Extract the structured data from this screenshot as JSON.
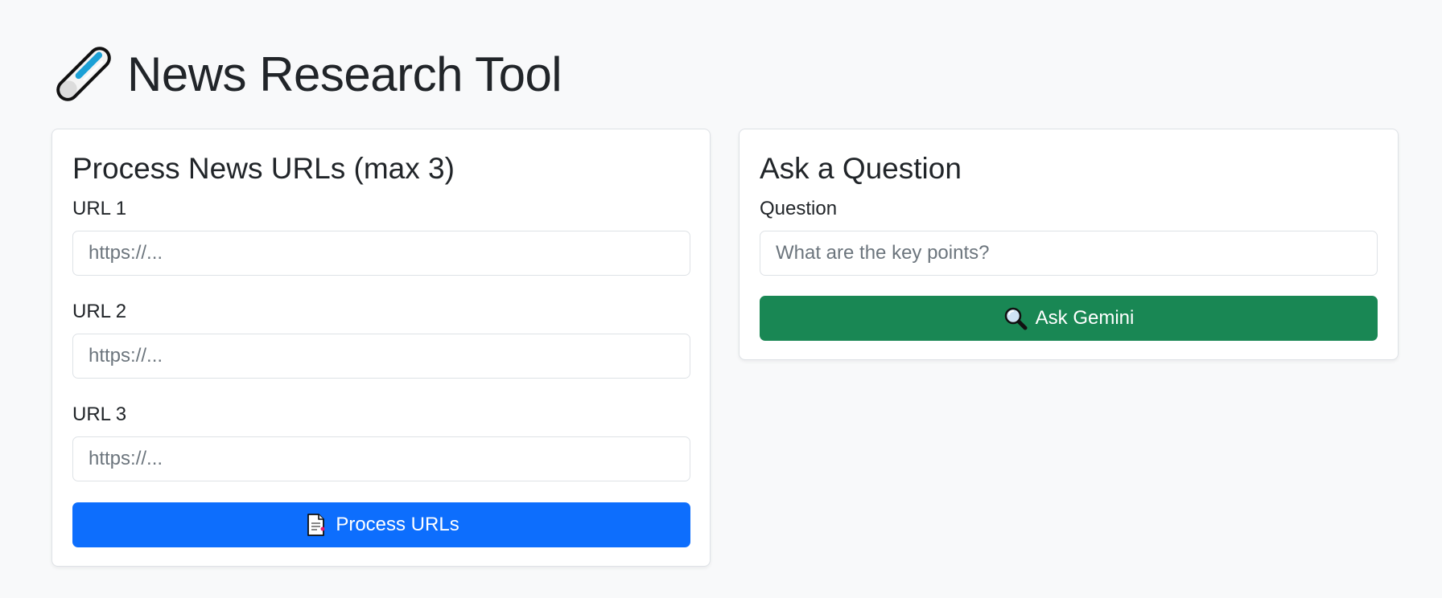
{
  "header": {
    "title": "News Research Tool",
    "icon": "pencil-icon"
  },
  "process_card": {
    "title": "Process News URLs (max 3)",
    "fields": [
      {
        "label": "URL 1",
        "placeholder": "https://...",
        "value": ""
      },
      {
        "label": "URL 2",
        "placeholder": "https://...",
        "value": ""
      },
      {
        "label": "URL 3",
        "placeholder": "https://...",
        "value": ""
      }
    ],
    "button": {
      "label": "Process URLs",
      "icon": "page-icon",
      "color": "#0d6efd"
    }
  },
  "question_card": {
    "title": "Ask a Question",
    "field": {
      "label": "Question",
      "placeholder": "What are the key points?",
      "value": ""
    },
    "button": {
      "label": "Ask Gemini",
      "icon": "magnifier-icon",
      "color": "#198754"
    }
  },
  "colors": {
    "background": "#f8f9fa",
    "card_border": "#dee2e6",
    "text": "#212529",
    "placeholder": "#6c757d"
  }
}
